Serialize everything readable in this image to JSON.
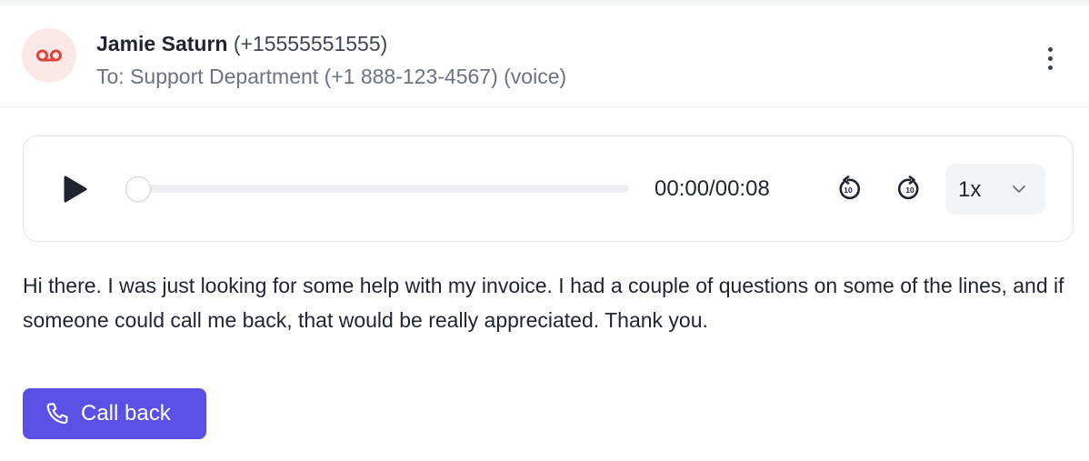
{
  "colors": {
    "accent": "#5b50e6",
    "voicemail_icon": "#e0453c",
    "avatar_bg": "#fde8e8"
  },
  "header": {
    "avatar_icon": "voicemail-icon",
    "caller_name": "Jamie Saturn",
    "caller_number": "(+15555551555)",
    "to_line": "To: Support Department (+1 888-123-4567) (voice)",
    "menu_icon": "more-vertical-icon"
  },
  "player": {
    "play_icon": "play-icon",
    "progress": 0,
    "time": "00:00/00:08",
    "skip_back_icon": "rewind-10-icon",
    "skip_forward_icon": "forward-10-icon",
    "speed": "1x",
    "speed_icon": "chevron-down-icon"
  },
  "transcript": "Hi there. I was just looking for some help with my invoice. I had a couple of questions on some of the lines, and if someone could call me back, that would be really appreciated. Thank you.",
  "actions": {
    "call_back_label": "Call back",
    "call_back_icon": "phone-icon"
  }
}
